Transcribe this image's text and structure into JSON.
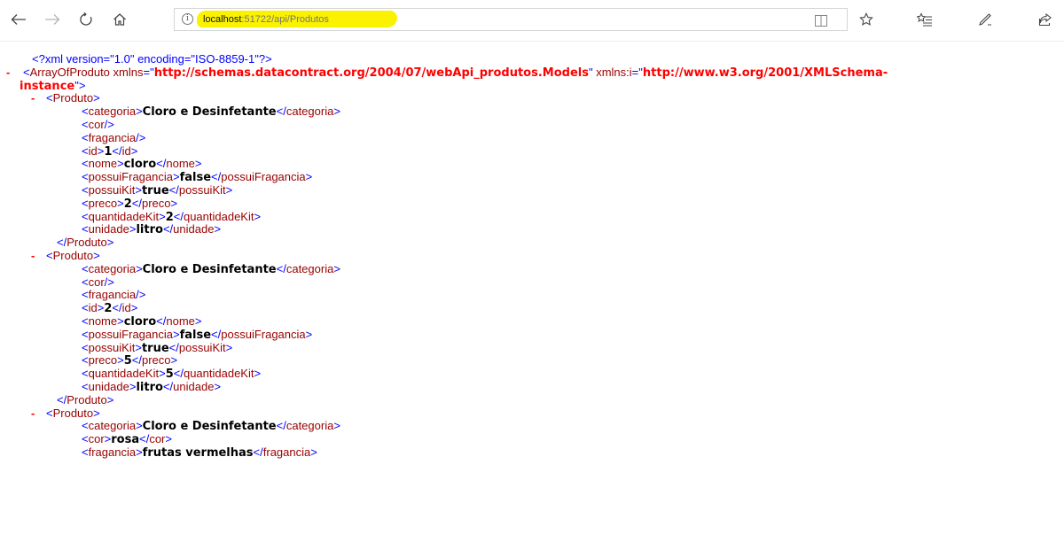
{
  "toolbar": {
    "back_icon": "back-arrow-icon",
    "forward_icon": "forward-arrow-icon",
    "refresh_icon": "refresh-icon",
    "home_icon": "home-icon",
    "info_glyph": "i",
    "url_host": "localhost",
    "url_path": ":51722/api/Produtos",
    "highlight_color": "#fbf200"
  },
  "xml": {
    "declaration": "<?xml version=\"1.0\" encoding=\"ISO-8859-1\"?>",
    "collapse_symbol": "-",
    "root_tag": "ArrayOfProduto",
    "xmlns_attr": "xmlns",
    "xmlns_value": "http://schemas.datacontract.org/2004/07/webApi_produtos.Models",
    "xmlns_i_attr": "xmlns:i",
    "xmlns_i_value_line1": "http://www.w3.org/2001/XMLSchema-",
    "xmlns_i_value_line2": "instance",
    "item_tag": "Produto",
    "produtos": [
      {
        "categoria": "Cloro e Desinfetante",
        "id": "1",
        "nome": "cloro",
        "possuiFragancia": "false",
        "possuiKit": "true",
        "preco": "2",
        "quantidadeKit": "2",
        "unidade": "litro"
      },
      {
        "categoria": "Cloro e Desinfetante",
        "id": "2",
        "nome": "cloro",
        "possuiFragancia": "false",
        "possuiKit": "true",
        "preco": "5",
        "quantidadeKit": "5",
        "unidade": "litro"
      },
      {
        "categoria": "Cloro e Desinfetante",
        "cor": "rosa",
        "fragancia": "frutas vermelhas"
      }
    ]
  }
}
